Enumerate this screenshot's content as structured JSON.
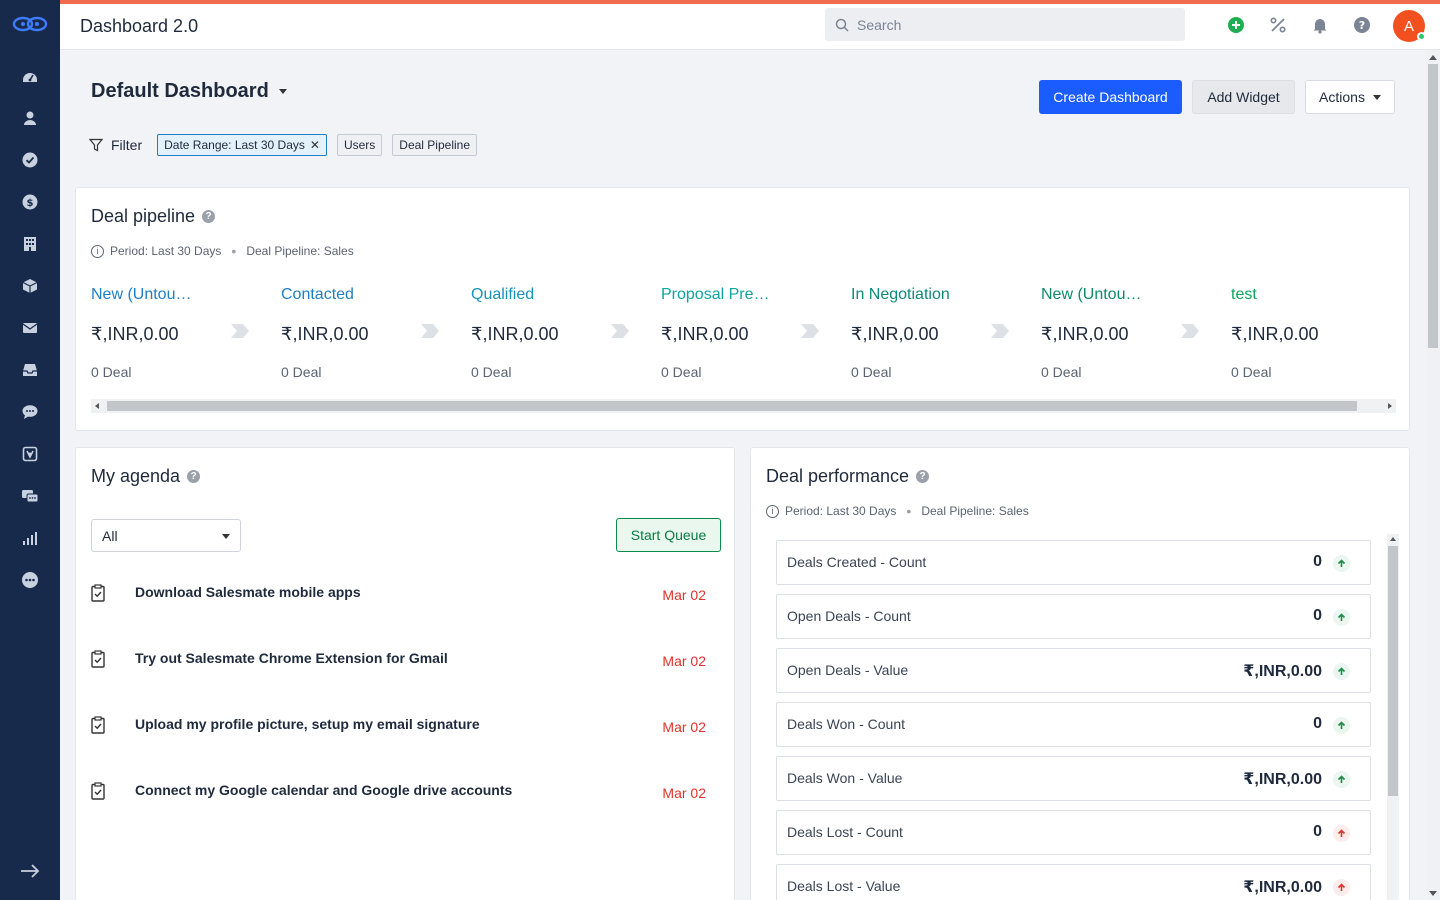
{
  "colors": {
    "sidebar": "#172a4b",
    "accent": "#1a5cff",
    "topbar_stripe": "#f26c4f",
    "overdue": "#e0322d",
    "stage_link": "#1f7fc4",
    "stage_teal": "#0ea5a0",
    "stage_green": "#0a7a42"
  },
  "sidebar": {
    "logo": "salesmate-logo",
    "items": [
      {
        "icon": "dashboard-icon"
      },
      {
        "icon": "contacts-icon"
      },
      {
        "icon": "tasks-icon"
      },
      {
        "icon": "deals-icon"
      },
      {
        "icon": "companies-icon"
      },
      {
        "icon": "products-icon"
      },
      {
        "icon": "email-icon"
      },
      {
        "icon": "inbox-icon"
      },
      {
        "icon": "chat-icon"
      },
      {
        "icon": "automation-icon"
      },
      {
        "icon": "messenger-icon"
      },
      {
        "icon": "reports-icon"
      },
      {
        "icon": "more-icon"
      }
    ],
    "expand_icon": "expand-arrow-icon"
  },
  "topbar": {
    "title": "Dashboard 2.0",
    "search_placeholder": "Search",
    "icons": [
      "add-icon",
      "percent-icon",
      "bell-icon",
      "help-icon"
    ],
    "avatar_initial": "A"
  },
  "header": {
    "dashboard_name": "Default Dashboard",
    "create_label": "Create Dashboard",
    "add_widget_label": "Add Widget",
    "actions_label": "Actions"
  },
  "filter": {
    "label": "Filter",
    "chips": [
      {
        "label": "Date Range: Last 30 Days",
        "removable": true
      },
      {
        "label": "Users"
      },
      {
        "label": "Deal Pipeline"
      }
    ]
  },
  "pipeline": {
    "title": "Deal pipeline",
    "period": "Period: Last 30 Days",
    "pipeline": "Deal Pipeline: Sales",
    "stages": [
      {
        "name": "New (Untou…",
        "value": "₹,INR,0.00",
        "count": "0 Deal",
        "color": "#1f7fc4"
      },
      {
        "name": "Contacted",
        "value": "₹,INR,0.00",
        "count": "0 Deal",
        "color": "#1f7fc4"
      },
      {
        "name": "Qualified",
        "value": "₹,INR,0.00",
        "count": "0 Deal",
        "color": "#1a91b8"
      },
      {
        "name": "Proposal Pre…",
        "value": "₹,INR,0.00",
        "count": "0 Deal",
        "color": "#0ea5a0"
      },
      {
        "name": "In Negotiation",
        "value": "₹,INR,0.00",
        "count": "0 Deal",
        "color": "#0e8a7a"
      },
      {
        "name": "New (Untou…",
        "value": "₹,INR,0.00",
        "count": "0 Deal",
        "color": "#0e8a6a"
      },
      {
        "name": "test",
        "value": "₹,INR,0.00",
        "count": "0 Deal",
        "color": "#0aa55a"
      }
    ]
  },
  "agenda": {
    "title": "My agenda",
    "filter_value": "All",
    "queue_label": "Start Queue",
    "items": [
      {
        "text": "Download Salesmate mobile apps",
        "date": "Mar 02"
      },
      {
        "text": "Try out Salesmate Chrome Extension for Gmail",
        "date": "Mar 02"
      },
      {
        "text": "Upload my profile picture, setup my email signature",
        "date": "Mar 02"
      },
      {
        "text": "Connect my Google calendar and Google drive accounts",
        "date": "Mar 02"
      }
    ]
  },
  "performance": {
    "title": "Deal performance",
    "period": "Period: Last 30 Days",
    "pipeline": "Deal Pipeline: Sales",
    "rows": [
      {
        "label": "Deals Created - Count",
        "value": "0",
        "trend": "up-green"
      },
      {
        "label": "Open Deals - Count",
        "value": "0",
        "trend": "up-green"
      },
      {
        "label": "Open Deals - Value",
        "value": "₹,INR,0.00",
        "trend": "up-green"
      },
      {
        "label": "Deals Won - Count",
        "value": "0",
        "trend": "up-green"
      },
      {
        "label": "Deals Won - Value",
        "value": "₹,INR,0.00",
        "trend": "up-green"
      },
      {
        "label": "Deals Lost - Count",
        "value": "0",
        "trend": "up-red"
      },
      {
        "label": "Deals Lost - Value",
        "value": "₹,INR,0.00",
        "trend": "up-red"
      }
    ]
  }
}
